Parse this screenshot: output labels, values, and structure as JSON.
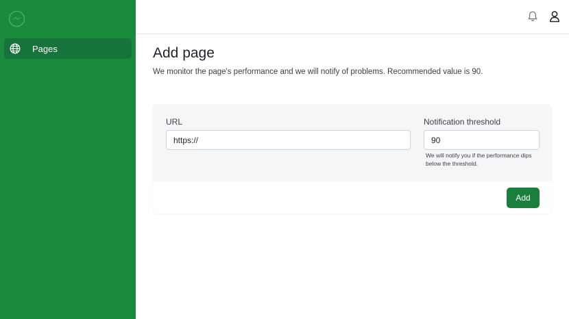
{
  "colors": {
    "sidebar_bg": "#1a8a3c",
    "sidebar_active_bg": "#16733a",
    "primary_button": "#1a7f3c"
  },
  "sidebar": {
    "logo_icon": "circle-logo-icon",
    "items": [
      {
        "icon": "globe-icon",
        "label": "Pages",
        "active": true
      }
    ]
  },
  "topbar": {
    "icons": [
      "bell-icon",
      "user-icon"
    ]
  },
  "main": {
    "title": "Add page",
    "description": "We monitor the page's performance and we will notify of problems. Recommended value is 90."
  },
  "form": {
    "url": {
      "label": "URL",
      "value": "https://"
    },
    "threshold": {
      "label": "Notification threshold",
      "value": "90",
      "help": "We will notify you if the performance dips below the threshold."
    },
    "submit_label": "Add"
  }
}
